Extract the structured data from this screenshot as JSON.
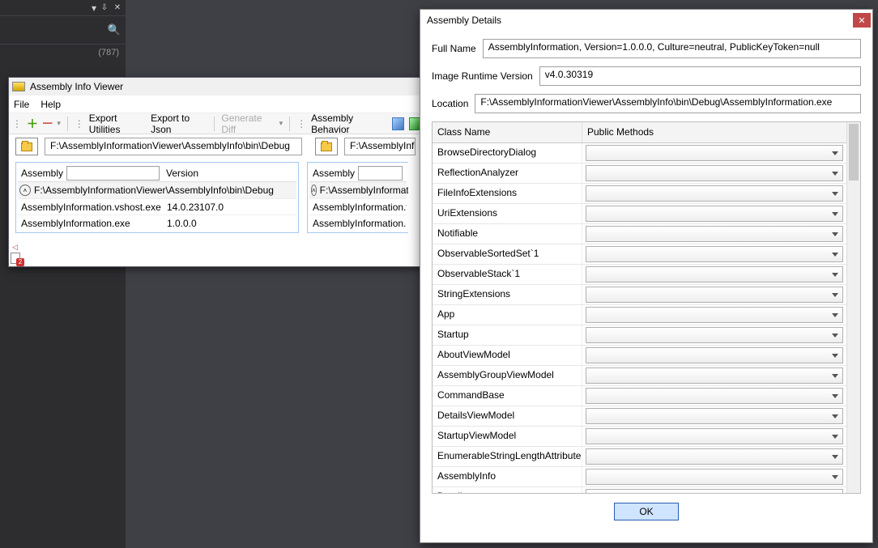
{
  "dark_panel": {
    "count": "(787)"
  },
  "app_window": {
    "title": "Assembly Info Viewer",
    "menu": {
      "file": "File",
      "help": "Help"
    },
    "toolbar": {
      "export_utilities": "Export Utilities",
      "export_json": "Export to Json",
      "generate_diff": "Generate Diff",
      "assembly_behavior": "Assembly Behavior"
    },
    "browse_path": "F:\\AssemblyInformationViewer\\AssemblyInfo\\bin\\Debug",
    "browse_path2": "F:\\AssemblyInfor",
    "panel1": {
      "h_assembly": "Assembly",
      "h_version": "Version",
      "group": "F:\\AssemblyInformationViewer\\AssemblyInfo\\bin\\Debug",
      "rows": [
        {
          "name": "AssemblyInformation.vshost.exe",
          "ver": "14.0.23107.0"
        },
        {
          "name": "AssemblyInformation.exe",
          "ver": "1.0.0.0"
        }
      ]
    },
    "panel2": {
      "group": "F:\\AssemblyInformation",
      "rows": [
        {
          "name": "AssemblyInformation.vs"
        },
        {
          "name": "AssemblyInformation.ex"
        }
      ]
    }
  },
  "dialog": {
    "title": "Assembly Details",
    "full_name_label": "Full Name",
    "full_name": "AssemblyInformation, Version=1.0.0.0, Culture=neutral, PublicKeyToken=null",
    "runtime_label": "Image Runtime Version",
    "runtime": "v4.0.30319",
    "location_label": "Location",
    "location": "F:\\AssemblyInformationViewer\\AssemblyInfo\\bin\\Debug\\AssemblyInformation.exe",
    "col_class": "Class Name",
    "col_methods": "Public Methods",
    "classes": [
      "BrowseDirectoryDialog",
      "ReflectionAnalyzer",
      "FileInfoExtensions",
      "UriExtensions",
      "Notifiable",
      "ObservableSortedSet`1",
      "ObservableStack`1",
      "StringExtensions",
      "App",
      "Startup",
      "AboutViewModel",
      "AssemblyGroupViewModel",
      "CommandBase",
      "DetailsViewModel",
      "StartupViewModel",
      "EnumerableStringLengthAttribute",
      "AssemblyInfo",
      "Details"
    ],
    "ok": "OK"
  }
}
